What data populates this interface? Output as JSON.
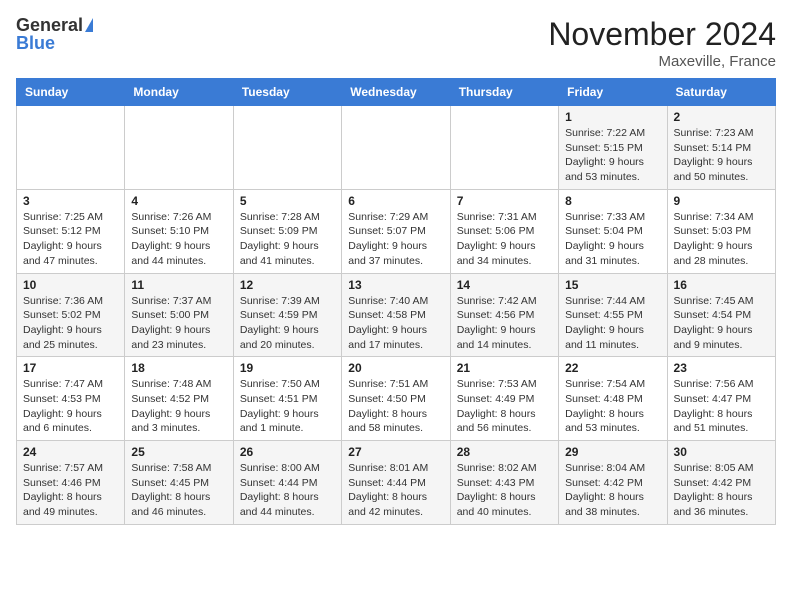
{
  "header": {
    "logo_general": "General",
    "logo_blue": "Blue",
    "month_title": "November 2024",
    "location": "Maxeville, France"
  },
  "weekdays": [
    "Sunday",
    "Monday",
    "Tuesday",
    "Wednesday",
    "Thursday",
    "Friday",
    "Saturday"
  ],
  "rows": [
    [
      {
        "day": "",
        "info": ""
      },
      {
        "day": "",
        "info": ""
      },
      {
        "day": "",
        "info": ""
      },
      {
        "day": "",
        "info": ""
      },
      {
        "day": "",
        "info": ""
      },
      {
        "day": "1",
        "info": "Sunrise: 7:22 AM\nSunset: 5:15 PM\nDaylight: 9 hours and 53 minutes."
      },
      {
        "day": "2",
        "info": "Sunrise: 7:23 AM\nSunset: 5:14 PM\nDaylight: 9 hours and 50 minutes."
      }
    ],
    [
      {
        "day": "3",
        "info": "Sunrise: 7:25 AM\nSunset: 5:12 PM\nDaylight: 9 hours and 47 minutes."
      },
      {
        "day": "4",
        "info": "Sunrise: 7:26 AM\nSunset: 5:10 PM\nDaylight: 9 hours and 44 minutes."
      },
      {
        "day": "5",
        "info": "Sunrise: 7:28 AM\nSunset: 5:09 PM\nDaylight: 9 hours and 41 minutes."
      },
      {
        "day": "6",
        "info": "Sunrise: 7:29 AM\nSunset: 5:07 PM\nDaylight: 9 hours and 37 minutes."
      },
      {
        "day": "7",
        "info": "Sunrise: 7:31 AM\nSunset: 5:06 PM\nDaylight: 9 hours and 34 minutes."
      },
      {
        "day": "8",
        "info": "Sunrise: 7:33 AM\nSunset: 5:04 PM\nDaylight: 9 hours and 31 minutes."
      },
      {
        "day": "9",
        "info": "Sunrise: 7:34 AM\nSunset: 5:03 PM\nDaylight: 9 hours and 28 minutes."
      }
    ],
    [
      {
        "day": "10",
        "info": "Sunrise: 7:36 AM\nSunset: 5:02 PM\nDaylight: 9 hours and 25 minutes."
      },
      {
        "day": "11",
        "info": "Sunrise: 7:37 AM\nSunset: 5:00 PM\nDaylight: 9 hours and 23 minutes."
      },
      {
        "day": "12",
        "info": "Sunrise: 7:39 AM\nSunset: 4:59 PM\nDaylight: 9 hours and 20 minutes."
      },
      {
        "day": "13",
        "info": "Sunrise: 7:40 AM\nSunset: 4:58 PM\nDaylight: 9 hours and 17 minutes."
      },
      {
        "day": "14",
        "info": "Sunrise: 7:42 AM\nSunset: 4:56 PM\nDaylight: 9 hours and 14 minutes."
      },
      {
        "day": "15",
        "info": "Sunrise: 7:44 AM\nSunset: 4:55 PM\nDaylight: 9 hours and 11 minutes."
      },
      {
        "day": "16",
        "info": "Sunrise: 7:45 AM\nSunset: 4:54 PM\nDaylight: 9 hours and 9 minutes."
      }
    ],
    [
      {
        "day": "17",
        "info": "Sunrise: 7:47 AM\nSunset: 4:53 PM\nDaylight: 9 hours and 6 minutes."
      },
      {
        "day": "18",
        "info": "Sunrise: 7:48 AM\nSunset: 4:52 PM\nDaylight: 9 hours and 3 minutes."
      },
      {
        "day": "19",
        "info": "Sunrise: 7:50 AM\nSunset: 4:51 PM\nDaylight: 9 hours and 1 minute."
      },
      {
        "day": "20",
        "info": "Sunrise: 7:51 AM\nSunset: 4:50 PM\nDaylight: 8 hours and 58 minutes."
      },
      {
        "day": "21",
        "info": "Sunrise: 7:53 AM\nSunset: 4:49 PM\nDaylight: 8 hours and 56 minutes."
      },
      {
        "day": "22",
        "info": "Sunrise: 7:54 AM\nSunset: 4:48 PM\nDaylight: 8 hours and 53 minutes."
      },
      {
        "day": "23",
        "info": "Sunrise: 7:56 AM\nSunset: 4:47 PM\nDaylight: 8 hours and 51 minutes."
      }
    ],
    [
      {
        "day": "24",
        "info": "Sunrise: 7:57 AM\nSunset: 4:46 PM\nDaylight: 8 hours and 49 minutes."
      },
      {
        "day": "25",
        "info": "Sunrise: 7:58 AM\nSunset: 4:45 PM\nDaylight: 8 hours and 46 minutes."
      },
      {
        "day": "26",
        "info": "Sunrise: 8:00 AM\nSunset: 4:44 PM\nDaylight: 8 hours and 44 minutes."
      },
      {
        "day": "27",
        "info": "Sunrise: 8:01 AM\nSunset: 4:44 PM\nDaylight: 8 hours and 42 minutes."
      },
      {
        "day": "28",
        "info": "Sunrise: 8:02 AM\nSunset: 4:43 PM\nDaylight: 8 hours and 40 minutes."
      },
      {
        "day": "29",
        "info": "Sunrise: 8:04 AM\nSunset: 4:42 PM\nDaylight: 8 hours and 38 minutes."
      },
      {
        "day": "30",
        "info": "Sunrise: 8:05 AM\nSunset: 4:42 PM\nDaylight: 8 hours and 36 minutes."
      }
    ]
  ]
}
